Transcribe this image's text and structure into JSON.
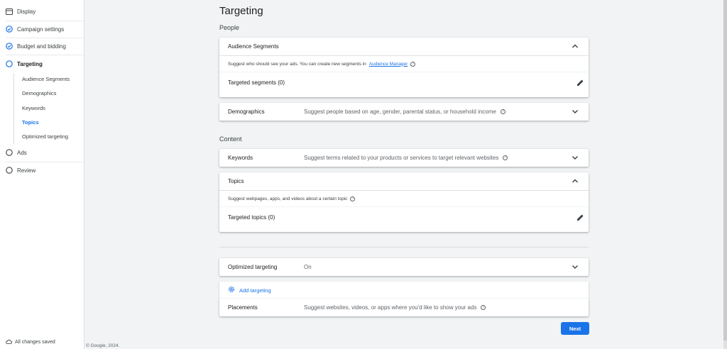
{
  "sidebar": {
    "steps": [
      {
        "label": "Display",
        "state": "campaign",
        "icon": "display-icon"
      },
      {
        "label": "Campaign settings",
        "state": "done",
        "icon": "check-circle-icon"
      },
      {
        "label": "Budget and bidding",
        "state": "done",
        "icon": "check-circle-icon"
      },
      {
        "label": "Targeting",
        "state": "active",
        "icon": "radio-circle-icon"
      },
      {
        "label": "Ads",
        "state": "todo",
        "icon": "radio-circle-icon"
      },
      {
        "label": "Review",
        "state": "todo",
        "icon": "radio-circle-icon"
      }
    ],
    "sub_items": [
      "Audience Segments",
      "Demographics",
      "Keywords",
      "Topics",
      "Optimized targeting"
    ],
    "current_sub": "Topics",
    "saved_status": "All changes saved"
  },
  "footer": {
    "copyright": "© Google, 2024."
  },
  "main": {
    "title": "Targeting",
    "people_label": "People",
    "content_label": "Content",
    "audience": {
      "title": "Audience Segments",
      "hint_prefix": "Suggest who should see your ads.  You can create new segments in",
      "hint_link": "Audience Manager",
      "row": "Targeted segments (0)"
    },
    "demographics": {
      "title": "Demographics",
      "desc": "Suggest people based on age, gender, parental status, or household income"
    },
    "keywords": {
      "title": "Keywords",
      "desc": "Suggest terms related to your products or services to target relevant websites"
    },
    "topics": {
      "title": "Topics",
      "hint": "Suggest webpages, apps, and videos about a certain topic",
      "row": "Targeted topics (0)"
    },
    "optimized": {
      "title": "Optimized targeting",
      "value": "On"
    },
    "add_targeting": "Add targeting",
    "placements": {
      "title": "Placements",
      "desc": "Suggest websites, videos, or apps where you'd like to show your ads"
    },
    "next_label": "Next"
  },
  "colors": {
    "accent": "#1a73e8",
    "background": "#f1f3f4"
  }
}
